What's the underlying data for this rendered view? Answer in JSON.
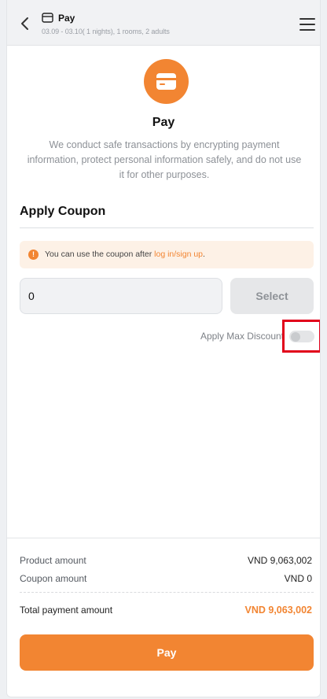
{
  "header": {
    "title": "Pay",
    "subtitle": "03.09 - 03.10( 1 nights), 1 rooms, 2 adults",
    "back_icon": "chevron-left-icon",
    "card_icon": "credit-card-icon",
    "menu_icon": "hamburger-menu-icon"
  },
  "hero": {
    "icon": "credit-card-icon",
    "title": "Pay",
    "description": "We conduct safe transactions by encrypting payment information, protect personal information safely, and do not use it for other purposes."
  },
  "coupon": {
    "title": "Apply Coupon",
    "notice_prefix": "You can use the coupon after ",
    "notice_link": "log in/sign up",
    "notice_suffix": ".",
    "input_value": "0",
    "select_label": "Select",
    "max_discount_label": "Apply Max Discount",
    "max_discount_enabled": false
  },
  "summary": {
    "product_label": "Product amount",
    "product_value": "VND 9,063,002",
    "coupon_label": "Coupon amount",
    "coupon_value": "VND 0",
    "total_label": "Total payment amount",
    "total_value": "VND 9,063,002"
  },
  "pay_button": {
    "label": "Pay"
  },
  "colors": {
    "accent": "#f28532",
    "highlight_border": "#e1001a"
  }
}
